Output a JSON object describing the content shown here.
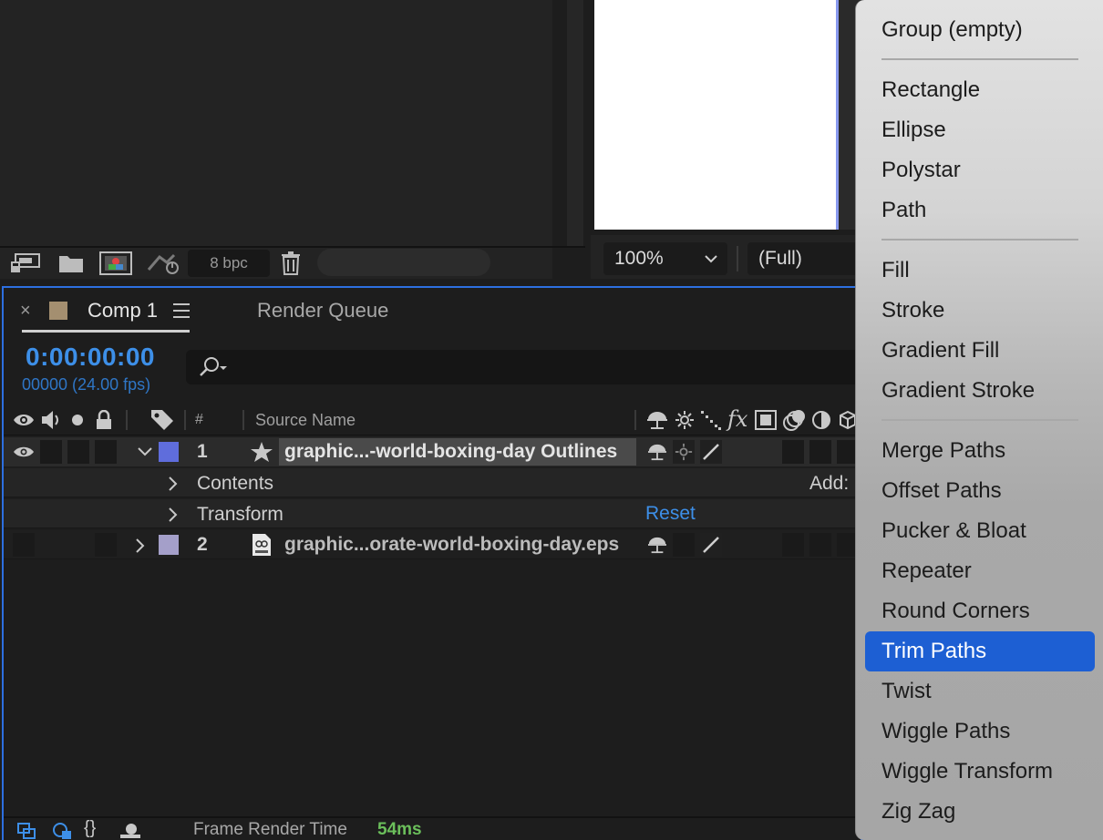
{
  "project_panel": {
    "bit_depth": "8 bpc"
  },
  "viewer": {
    "zoom": "100%",
    "resolution": "(Full)"
  },
  "timeline": {
    "tab_label": "Comp 1",
    "render_queue_label": "Render Queue",
    "timecode": "0:00:00:00",
    "frame_info": "00000 (24.00 fps)",
    "search_placeholder": "",
    "columns": {
      "number": "#",
      "source_name": "Source Name"
    },
    "layers": [
      {
        "number": "1",
        "name": "graphic...-world-boxing-day Outlines",
        "label_color": "#5f6ddc"
      },
      {
        "number": "2",
        "name": "graphic...orate-world-boxing-day.eps",
        "label_color": "#a49fc9"
      }
    ],
    "contents_label": "Contents",
    "add_label": "Add:",
    "transform_label": "Transform",
    "reset_label": "Reset",
    "status": {
      "render_time_label": "Frame Render Time",
      "render_time_value": "54ms"
    },
    "accent_color": "#3d8fe8"
  },
  "add_menu": {
    "items": [
      "Group (empty)",
      "Rectangle",
      "Ellipse",
      "Polystar",
      "Path",
      "Fill",
      "Stroke",
      "Gradient Fill",
      "Gradient Stroke",
      "Merge Paths",
      "Offset Paths",
      "Pucker & Bloat",
      "Repeater",
      "Round Corners",
      "Trim Paths",
      "Twist",
      "Wiggle Paths",
      "Wiggle Transform",
      "Zig Zag"
    ],
    "highlighted_item": "Trim Paths",
    "highlight_color": "#1d5fd3"
  },
  "icons": [
    "new-comp-icon",
    "folder-icon",
    "footage-icon",
    "flowchart-icon",
    "trash-icon",
    "search-icon",
    "eye-icon",
    "audio-icon",
    "solo-icon",
    "lock-icon",
    "label-tag-icon",
    "star-icon",
    "eps-file-icon",
    "shy-icon",
    "sun-icon",
    "fx-icon",
    "motion-blur-icon",
    "adjustment-icon",
    "3d-icon"
  ]
}
